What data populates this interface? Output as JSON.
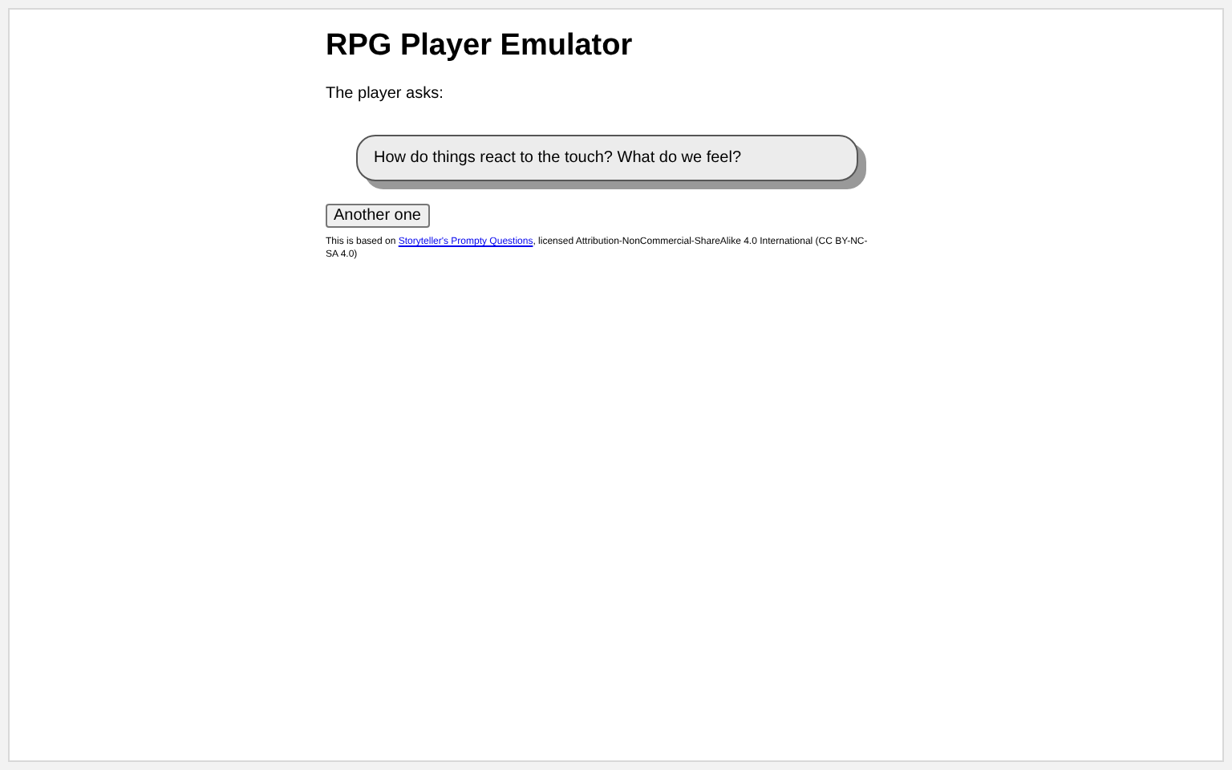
{
  "title": "RPG Player Emulator",
  "intro": "The player asks:",
  "question": "How do things react to the touch? What do we feel?",
  "button": "Another one",
  "footer": {
    "before": "This is based on ",
    "link": "Storyteller's Prompty Questions",
    "after": ", licensed Attribution-NonCommercial-ShareAlike 4.0 International (CC BY-NC-SA 4.0)"
  }
}
